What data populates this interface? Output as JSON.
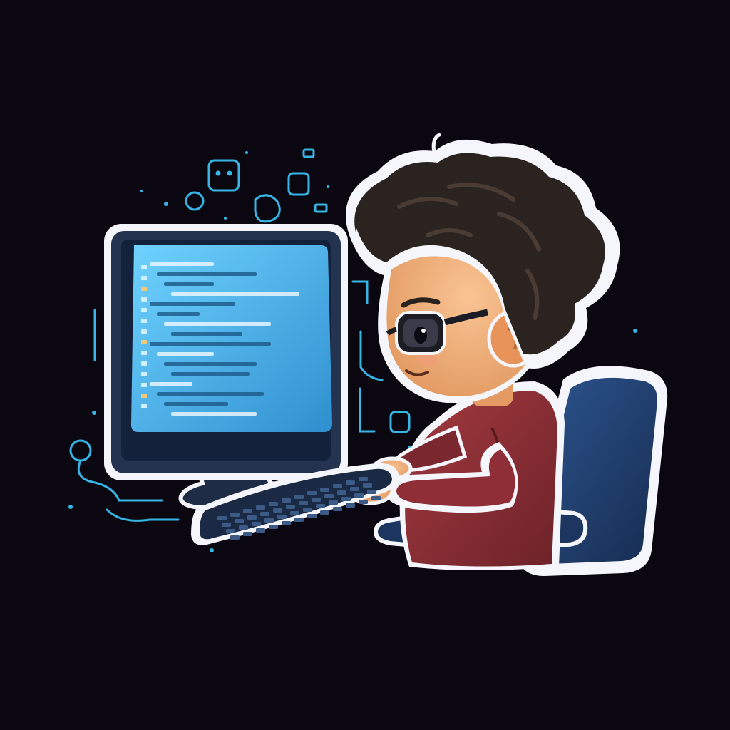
{
  "colors": {
    "background": "#0b0710",
    "screen_glow": "#5bc8ff",
    "screen_dark": "#1a4f7a",
    "monitor_frame": "#24334f",
    "outline": "#f4f6fb",
    "hair": "#2a221f",
    "skin": "#f3b07c",
    "sweater": "#8a2b33",
    "chair": "#1f3a66",
    "doodle": "#37b6e6"
  },
  "illustration": {
    "subject": "person-coding-at-computer",
    "icons": [
      "monitor-icon",
      "keyboard-icon",
      "chair-icon",
      "glasses-icon",
      "code-doodle-icon"
    ]
  }
}
